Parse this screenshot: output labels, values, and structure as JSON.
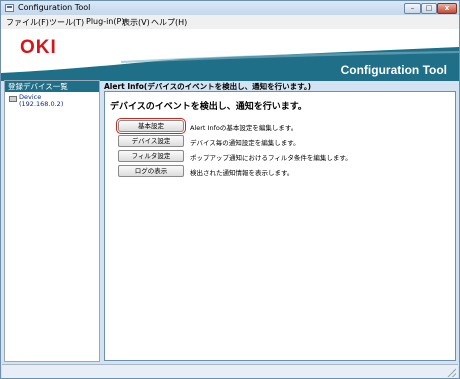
{
  "window": {
    "title": "Configuration Tool",
    "controls": {
      "minimize": "–",
      "maximize": "□",
      "close": "x"
    }
  },
  "menu": {
    "items": [
      "ファイル(F)",
      "ツール(T)",
      "Plug-in(P)",
      "表示(V)",
      "ヘルプ(H)"
    ]
  },
  "header": {
    "logo": "OKI",
    "product_title": "Configuration Tool",
    "colors": {
      "logo": "#d7141a",
      "band": "#1f6f89"
    }
  },
  "sidebar": {
    "heading": "登録デバイス一覧",
    "devices": [
      {
        "name": "Device",
        "ip": "(192.168.0.2)",
        "icon": "printer-icon"
      }
    ]
  },
  "main": {
    "heading": "Alert Info(デバイスのイベントを検出し、通知を行います。)",
    "panel_title": "デバイスのイベントを検出し、通知を行います。",
    "rows": [
      {
        "button": "基本設定",
        "desc": "Alert Infoの基本設定を編集します。",
        "highlighted": true
      },
      {
        "button": "デバイス設定",
        "desc": "デバイス毎の通知設定を編集します。",
        "highlighted": false
      },
      {
        "button": "フィルタ設定",
        "desc": "ポップアップ通知におけるフィルタ条件を編集します。",
        "highlighted": false
      },
      {
        "button": "ログの表示",
        "desc": "検出された通知情報を表示します。",
        "highlighted": false
      }
    ]
  }
}
